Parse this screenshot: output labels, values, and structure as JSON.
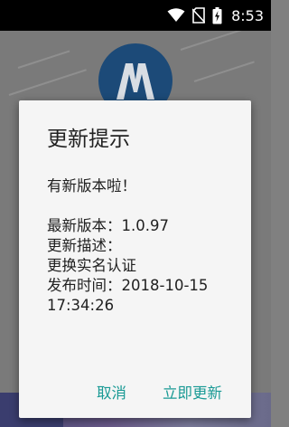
{
  "status_bar": {
    "time": "8:53",
    "icons": [
      "wifi-icon",
      "no-sim-icon",
      "battery-charging-icon"
    ]
  },
  "background": {
    "logo_icon": "app-logo-icon"
  },
  "dialog": {
    "title": "更新提示",
    "message_lines": [
      "有新版本啦！",
      "",
      "最新版本：1.0.97",
      "更新描述：",
      "更换实名认证",
      "发布时间：2018-10-15",
      "17:34:26"
    ],
    "cancel_label": "取消",
    "update_label": "立即更新"
  },
  "colors": {
    "accent": "#1a9a95",
    "dialog_bg": "#f5f5f5",
    "scrim": "#7a7a7a",
    "status_bar": "#000000"
  }
}
